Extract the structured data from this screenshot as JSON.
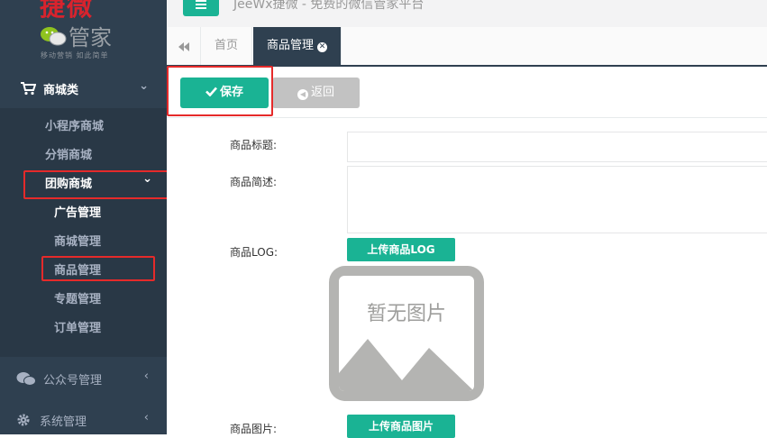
{
  "brand": {
    "logo_main": "捷微",
    "logo_sub": "管家",
    "slogan": "移动营销  如此简单"
  },
  "topbar": {
    "title": "JeeWx捷微 - 免费的微信管家平台"
  },
  "sidebar": {
    "categories": [
      {
        "label": "商城类",
        "icon": "cart-icon",
        "chevron": "⌄"
      },
      {
        "label": "公众号管理",
        "icon": "wechat-icon",
        "chevron": "‹"
      },
      {
        "label": "系统管理",
        "icon": "gear-icon",
        "chevron": "‹"
      }
    ],
    "mall_items": [
      {
        "label": "小程序商城"
      },
      {
        "label": "分销商城"
      },
      {
        "label": "团购商城",
        "chevron": "⌄"
      }
    ],
    "group_items": [
      {
        "label": "广告管理"
      },
      {
        "label": "商城管理"
      },
      {
        "label": "商品管理"
      },
      {
        "label": "专题管理"
      },
      {
        "label": "订单管理"
      }
    ]
  },
  "tabs": [
    {
      "label": "首页"
    },
    {
      "label": "商品管理",
      "close": "✕"
    }
  ],
  "toolbar": {
    "save_label": "保存",
    "back_label": "返回"
  },
  "form": {
    "title_label": "商品标题:",
    "desc_label": "商品简述:",
    "logo_label": "商品LOG:",
    "upload_logo": "上传商品LOG",
    "no_image": "暂无图片",
    "pic_label": "商品图片:",
    "upload_pic": "上传商品图片"
  },
  "colors": {
    "sidebar": "#2f4050",
    "accent": "#1ab394",
    "highlight": "#e52a2a"
  }
}
